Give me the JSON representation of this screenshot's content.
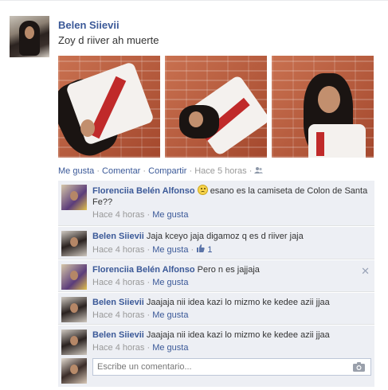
{
  "post": {
    "author": "Belen Siievii",
    "status": "Zoy d riiver ah muerte",
    "photos": [
      "photo-1",
      "photo-2",
      "photo-3"
    ],
    "actions": {
      "like": "Me gusta",
      "comment": "Comentar",
      "share": "Compartir",
      "time": "Hace 5 horas",
      "privacy_icon": "friends-icon"
    }
  },
  "comments": [
    {
      "author": "Florenciia Belén Alfonso",
      "emoji": "smiley-icon",
      "text": "esano es la camiseta de Colon de Santa Fe??",
      "time": "Hace 4 horas",
      "like": "Me gusta"
    },
    {
      "author": "Belen Siievii",
      "text": "Jaja kceyo jaja digamoz q es d riiver jaja",
      "time": "Hace 4 horas",
      "like": "Me gusta",
      "like_count": "1"
    },
    {
      "author": "Florenciia Belén Alfonso",
      "text": "Pero n es jajjaja",
      "time": "Hace 4 horas",
      "like": "Me gusta"
    },
    {
      "author": "Belen Siievii",
      "text": "Jaajaja nii idea kazi lo mizmo ke kedee azii jjaa",
      "time": "Hace 4 horas",
      "like": "Me gusta"
    },
    {
      "author": "Belen Siievii",
      "text": "Jaajaja nii idea kazi lo mizmo ke kedee azii jjaa",
      "time": "Hace 4 horas",
      "like": "Me gusta"
    }
  ],
  "reply": {
    "placeholder": "Escribe un comentario..."
  },
  "colors": {
    "link": "#3b5998",
    "comment_bg": "#edeff4",
    "meta": "#999999"
  }
}
